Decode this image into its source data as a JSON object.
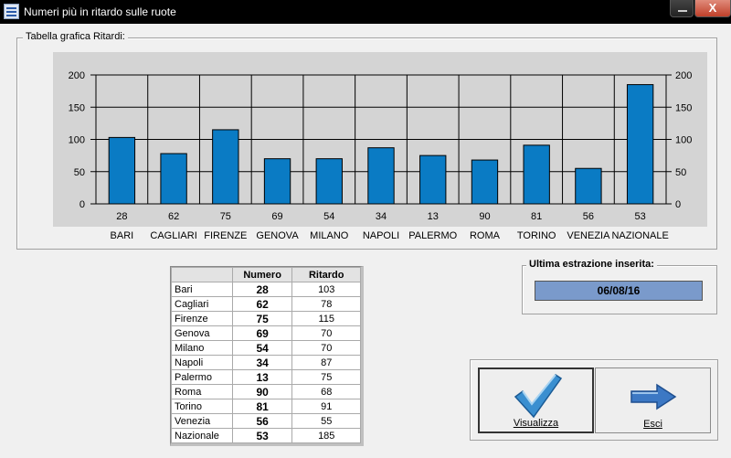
{
  "window": {
    "title": "Numeri più in ritardo sulle ruote",
    "close_symbol": "X"
  },
  "chart_group": {
    "legend": "Tabella grafica Ritardi:"
  },
  "chart_data": {
    "type": "bar",
    "categories": [
      "BARI",
      "CAGLIARI",
      "FIRENZE",
      "GENOVA",
      "MILANO",
      "NAPOLI",
      "PALERMO",
      "ROMA",
      "TORINO",
      "VENEZIA",
      "NAZIONALE"
    ],
    "numbers": [
      "28",
      "62",
      "75",
      "69",
      "54",
      "34",
      "13",
      "90",
      "81",
      "56",
      "53"
    ],
    "values": [
      103,
      78,
      115,
      70,
      70,
      87,
      75,
      68,
      91,
      55,
      185
    ],
    "yticks": [
      0,
      50,
      100,
      150,
      200
    ],
    "ylim": [
      0,
      200
    ],
    "bar_color": "#0a7bc4",
    "plot_bg": "#d4d4d4",
    "grid": true
  },
  "table": {
    "headers": [
      "",
      "Numero",
      "Ritardo"
    ],
    "rows": [
      {
        "ruota": "Bari",
        "numero": "28",
        "ritardo": "103"
      },
      {
        "ruota": "Cagliari",
        "numero": "62",
        "ritardo": "78"
      },
      {
        "ruota": "Firenze",
        "numero": "75",
        "ritardo": "115"
      },
      {
        "ruota": "Genova",
        "numero": "69",
        "ritardo": "70"
      },
      {
        "ruota": "Milano",
        "numero": "54",
        "ritardo": "70"
      },
      {
        "ruota": "Napoli",
        "numero": "34",
        "ritardo": "87"
      },
      {
        "ruota": "Palermo",
        "numero": "13",
        "ritardo": "75"
      },
      {
        "ruota": "Roma",
        "numero": "90",
        "ritardo": "68"
      },
      {
        "ruota": "Torino",
        "numero": "81",
        "ritardo": "91"
      },
      {
        "ruota": "Venezia",
        "numero": "56",
        "ritardo": "55"
      },
      {
        "ruota": "Nazionale",
        "numero": "53",
        "ritardo": "185"
      }
    ]
  },
  "last_extraction": {
    "legend": "Ultima estrazione inserita:",
    "date": "06/08/16"
  },
  "buttons": {
    "visualizza": {
      "label": "Visualizza",
      "icon": "checkmark-icon"
    },
    "esci": {
      "label": "Esci",
      "icon": "arrow-right-icon"
    }
  }
}
